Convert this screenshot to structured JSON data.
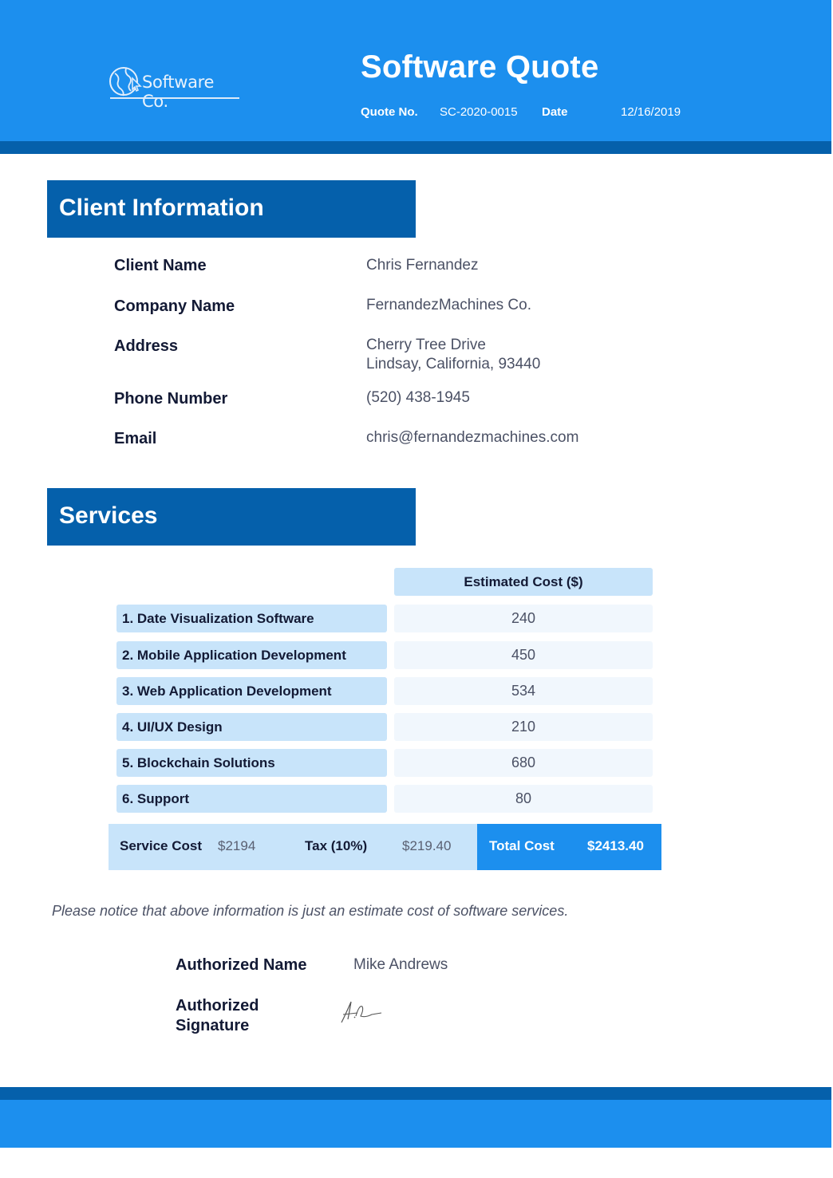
{
  "header": {
    "logo_text": "Software Co.",
    "logo_icon": "globe-cursor-icon",
    "title": "Software Quote",
    "quote_no_label": "Quote No.",
    "quote_no_value": "SC-2020-0015",
    "date_label": "Date",
    "date_value": "12/16/2019"
  },
  "client": {
    "section_title": "Client Information",
    "fields": [
      {
        "label": "Client Name",
        "value": "Chris Fernandez"
      },
      {
        "label": "Company Name",
        "value": "FernandezMachines Co."
      },
      {
        "label": "Address",
        "value": "Cherry Tree Drive",
        "value2": "Lindsay, California, 93440"
      },
      {
        "label": "Phone Number",
        "value": "(520) 438-1945"
      },
      {
        "label": "Email",
        "value": "chris@fernandezmachines.com"
      }
    ]
  },
  "services": {
    "section_title": "Services",
    "cost_header": "Estimated Cost ($)",
    "items": [
      {
        "name": "1. Date Visualization Software",
        "cost": "240"
      },
      {
        "name": "2. Mobile Application Development",
        "cost": "450"
      },
      {
        "name": "3. Web Application Development",
        "cost": "534"
      },
      {
        "name": "4. UI/UX Design",
        "cost": "210"
      },
      {
        "name": "5. Blockchain Solutions",
        "cost": "680"
      },
      {
        "name": "6. Support",
        "cost": "80"
      }
    ],
    "summary": {
      "service_cost_label": "Service Cost",
      "service_cost_value": "$2194",
      "tax_label": "Tax (10%)",
      "tax_value": "$219.40",
      "total_label": "Total Cost",
      "total_value": "$2413.40"
    }
  },
  "notice": "Please notice that above information is just an estimate cost of software services.",
  "authorization": {
    "name_label": "Authorized Name",
    "name_value": "Mike Andrews",
    "signature_label_line1": "Authorized",
    "signature_label_line2": "Signature",
    "signature_icon": "signature-icon"
  },
  "colors": {
    "primary": "#1c8fee",
    "dark": "#0560ab",
    "light": "#c8e4fa",
    "row_bg": "#f1f7fd",
    "text_dark": "#131a35",
    "text_muted": "#4b5165"
  }
}
